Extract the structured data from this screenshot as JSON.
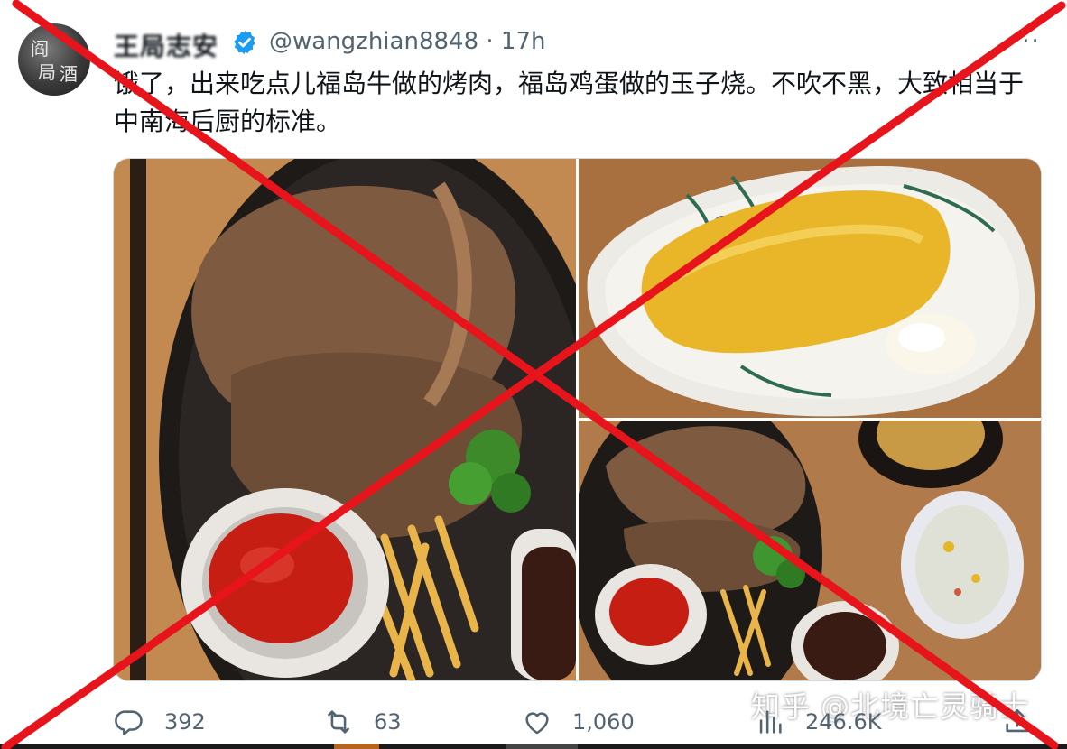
{
  "tweet": {
    "author_name": "王局志安",
    "handle": "@wangzhian8848",
    "separator": "·",
    "time": "17h",
    "more_label": "···",
    "text": "饿了，出来吃点儿福岛牛做的烤肉，福岛鸡蛋做的玉子烧。不吹不黑，大致相当于中南海后厨的标准。",
    "avatar_chars": [
      "阎",
      "局",
      "酒"
    ]
  },
  "actions": {
    "replies": "392",
    "retweets": "63",
    "likes": "1,060",
    "views": "246.6K"
  },
  "watermark": "知乎 @北境亡灵骑士",
  "colors": {
    "accent": "#1d9bf0",
    "secondary_text": "#536471",
    "cross": "#e8141b"
  },
  "icons": [
    "verified-badge-icon",
    "more-icon",
    "reply-icon",
    "retweet-icon",
    "like-icon",
    "views-icon",
    "share-icon"
  ]
}
